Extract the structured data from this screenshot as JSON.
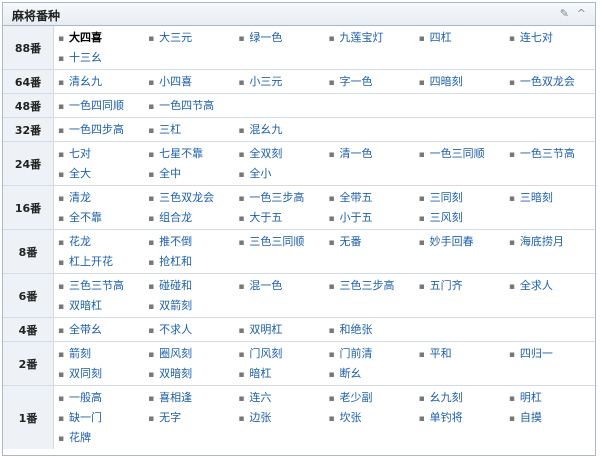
{
  "header": {
    "title": "麻将番种",
    "edit_glyph": "✎",
    "collapse_glyph": "^"
  },
  "bullet": "▪",
  "groups": [
    {
      "level": "88番",
      "items": [
        {
          "label": "大四喜",
          "current": true
        },
        {
          "label": "大三元"
        },
        {
          "label": "绿一色"
        },
        {
          "label": "九莲宝灯"
        },
        {
          "label": "四杠"
        },
        {
          "label": "连七对"
        },
        {
          "label": "十三幺"
        }
      ]
    },
    {
      "level": "64番",
      "items": [
        {
          "label": "清幺九"
        },
        {
          "label": "小四喜"
        },
        {
          "label": "小三元"
        },
        {
          "label": "字一色"
        },
        {
          "label": "四暗刻"
        },
        {
          "label": "一色双龙会"
        }
      ]
    },
    {
      "level": "48番",
      "items": [
        {
          "label": "一色四同顺"
        },
        {
          "label": "一色四节高"
        }
      ]
    },
    {
      "level": "32番",
      "items": [
        {
          "label": "一色四步高"
        },
        {
          "label": "三杠"
        },
        {
          "label": "混幺九"
        }
      ]
    },
    {
      "level": "24番",
      "items": [
        {
          "label": "七对"
        },
        {
          "label": "七星不靠"
        },
        {
          "label": "全双刻"
        },
        {
          "label": "清一色"
        },
        {
          "label": "一色三同顺"
        },
        {
          "label": "一色三节高"
        },
        {
          "label": "全大"
        },
        {
          "label": "全中"
        },
        {
          "label": "全小"
        }
      ]
    },
    {
      "level": "16番",
      "items": [
        {
          "label": "清龙"
        },
        {
          "label": "三色双龙会"
        },
        {
          "label": "一色三步高"
        },
        {
          "label": "全带五"
        },
        {
          "label": "三同刻"
        },
        {
          "label": "三暗刻"
        },
        {
          "label": "全不靠"
        },
        {
          "label": "组合龙"
        },
        {
          "label": "大于五"
        },
        {
          "label": "小于五"
        },
        {
          "label": "三风刻"
        }
      ]
    },
    {
      "level": "8番",
      "items": [
        {
          "label": "花龙"
        },
        {
          "label": "推不倒"
        },
        {
          "label": "三色三同顺"
        },
        {
          "label": "无番"
        },
        {
          "label": "妙手回春"
        },
        {
          "label": "海底捞月"
        },
        {
          "label": "杠上开花"
        },
        {
          "label": "抢杠和"
        }
      ]
    },
    {
      "level": "6番",
      "items": [
        {
          "label": "三色三节高"
        },
        {
          "label": "碰碰和"
        },
        {
          "label": "混一色"
        },
        {
          "label": "三色三步高"
        },
        {
          "label": "五门齐"
        },
        {
          "label": "全求人"
        },
        {
          "label": "双暗杠"
        },
        {
          "label": "双箭刻"
        }
      ]
    },
    {
      "level": "4番",
      "items": [
        {
          "label": "全带幺"
        },
        {
          "label": "不求人"
        },
        {
          "label": "双明杠"
        },
        {
          "label": "和绝张"
        }
      ]
    },
    {
      "level": "2番",
      "items": [
        {
          "label": "箭刻"
        },
        {
          "label": "圈风刻"
        },
        {
          "label": "门风刻"
        },
        {
          "label": "门前清"
        },
        {
          "label": "平和"
        },
        {
          "label": "四归一"
        },
        {
          "label": "双同刻"
        },
        {
          "label": "双暗刻"
        },
        {
          "label": "暗杠"
        },
        {
          "label": "断幺"
        }
      ]
    },
    {
      "level": "1番",
      "items": [
        {
          "label": "一般高"
        },
        {
          "label": "喜相逢"
        },
        {
          "label": "连六"
        },
        {
          "label": "老少副"
        },
        {
          "label": "幺九刻"
        },
        {
          "label": "明杠"
        },
        {
          "label": "缺一门"
        },
        {
          "label": "无字"
        },
        {
          "label": "边张"
        },
        {
          "label": "坎张"
        },
        {
          "label": "单钓将"
        },
        {
          "label": "自摸"
        },
        {
          "label": "花牌"
        }
      ]
    }
  ]
}
